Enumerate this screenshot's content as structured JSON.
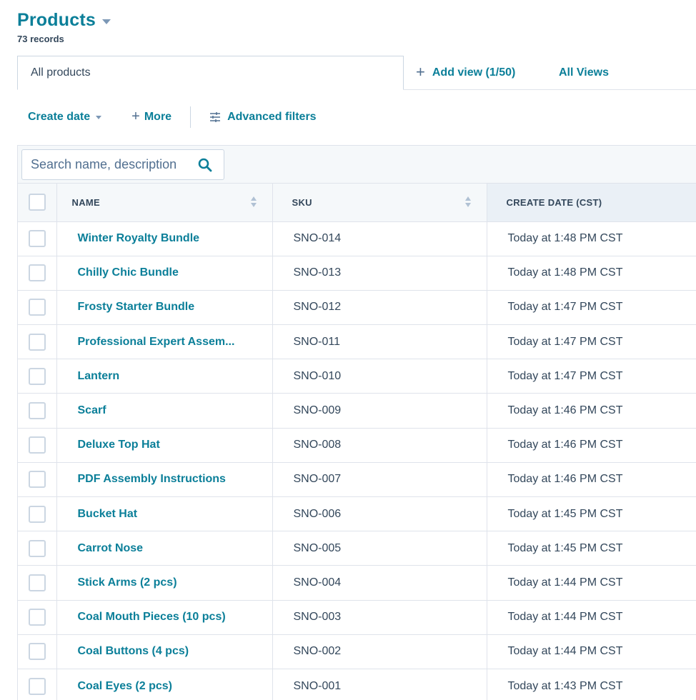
{
  "header": {
    "title": "Products",
    "record_count": "73 records"
  },
  "tabs": {
    "active_tab": "All products",
    "add_view": "Add view (1/50)",
    "all_views": "All Views"
  },
  "filters": {
    "create_date": "Create date",
    "more": "More",
    "advanced": "Advanced filters"
  },
  "search": {
    "placeholder": "Search name, description",
    "value": ""
  },
  "table": {
    "columns": {
      "name": "NAME",
      "sku": "SKU",
      "create_date": "CREATE DATE (CST)"
    },
    "rows": [
      {
        "name": "Winter Royalty Bundle",
        "sku": "SNO-014",
        "date": "Today at 1:48 PM CST"
      },
      {
        "name": "Chilly Chic Bundle",
        "sku": "SNO-013",
        "date": "Today at 1:48 PM CST"
      },
      {
        "name": "Frosty Starter Bundle",
        "sku": "SNO-012",
        "date": "Today at 1:47 PM CST"
      },
      {
        "name": "Professional Expert Assem...",
        "sku": "SNO-011",
        "date": "Today at 1:47 PM CST"
      },
      {
        "name": "Lantern",
        "sku": "SNO-010",
        "date": "Today at 1:47 PM CST"
      },
      {
        "name": "Scarf",
        "sku": "SNO-009",
        "date": "Today at 1:46 PM CST"
      },
      {
        "name": "Deluxe Top Hat",
        "sku": "SNO-008",
        "date": "Today at 1:46 PM CST"
      },
      {
        "name": "PDF Assembly Instructions",
        "sku": "SNO-007",
        "date": "Today at 1:46 PM CST"
      },
      {
        "name": "Bucket Hat",
        "sku": "SNO-006",
        "date": "Today at 1:45 PM CST"
      },
      {
        "name": "Carrot Nose",
        "sku": "SNO-005",
        "date": "Today at 1:45 PM CST"
      },
      {
        "name": "Stick Arms (2 pcs)",
        "sku": "SNO-004",
        "date": "Today at 1:44 PM CST"
      },
      {
        "name": "Coal Mouth Pieces (10 pcs)",
        "sku": "SNO-003",
        "date": "Today at 1:44 PM CST"
      },
      {
        "name": "Coal Buttons (4 pcs)",
        "sku": "SNO-002",
        "date": "Today at 1:44 PM CST"
      },
      {
        "name": "Coal Eyes (2 pcs)",
        "sku": "SNO-001",
        "date": "Today at 1:43 PM CST"
      }
    ]
  },
  "colors": {
    "accent": "#0b7f99",
    "text": "#33475b",
    "border": "#dfe3eb",
    "header_bg": "#f5f8fa",
    "sorted_header_bg": "#eaf0f6"
  }
}
